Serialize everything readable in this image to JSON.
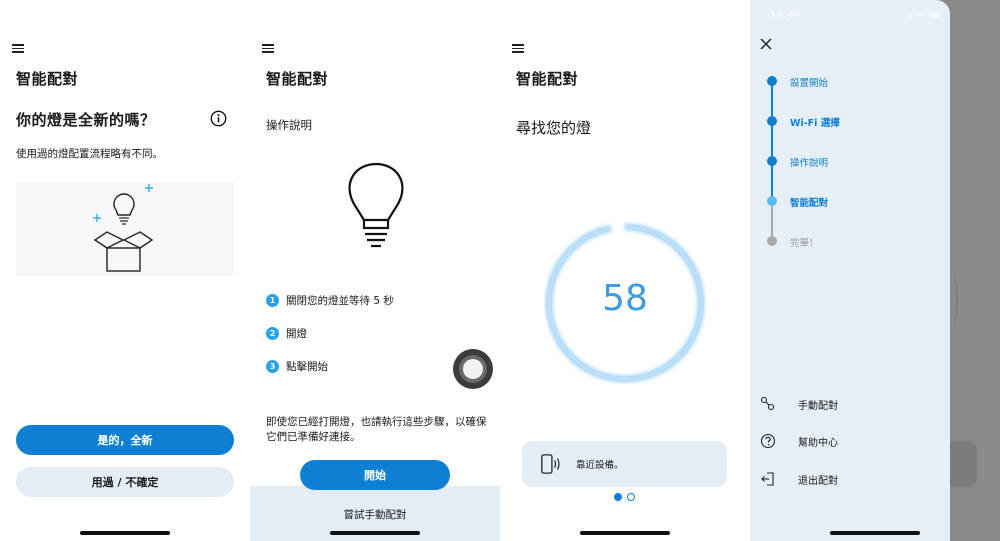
{
  "screen1": {
    "title": "智能配對",
    "question": "你的燈是全新的嗎？",
    "subtitle": "使用過的燈配置流程略有不同。",
    "primary_button": "是的，全新",
    "secondary_button": "用過 / 不確定"
  },
  "screen2": {
    "title": "智能配對",
    "section_label": "操作說明",
    "steps": [
      {
        "num": "1",
        "text": "關閉您的燈並等待 5 秒"
      },
      {
        "num": "2",
        "text": "開燈"
      },
      {
        "num": "3",
        "text": "點擊開始"
      }
    ],
    "note": "即使您已經打開燈，也請執行這些步驟，以確保它們已準備好連接。",
    "start_button": "開始",
    "manual_button": "嘗試手動配對"
  },
  "screen3": {
    "title": "智能配對",
    "searching_text": "尋找您的燈",
    "countdown": "58",
    "countdown_progress_fraction": 0.97,
    "near_device_text": "靠近設備。",
    "pager": {
      "current": 1,
      "total": 2
    }
  },
  "screen4": {
    "status_time": "12:40",
    "timeline": [
      {
        "label": "設置開始",
        "state": "done"
      },
      {
        "label": "Wi-Fi 選擇",
        "state": "done"
      },
      {
        "label": "操作說明",
        "state": "done"
      },
      {
        "label": "智能配對",
        "state": "current"
      },
      {
        "label": "完畢！",
        "state": "pending"
      }
    ],
    "menu": [
      {
        "label": "手動配對",
        "icon": "manual-pair-icon"
      },
      {
        "label": "幫助中心",
        "icon": "help-icon"
      },
      {
        "label": "退出配對",
        "icon": "exit-icon"
      }
    ]
  },
  "colors": {
    "primary": "#0f7fd4",
    "light_accent": "#29a1ea",
    "panel": "#e4edf6",
    "pending": "#a8a8a8"
  }
}
